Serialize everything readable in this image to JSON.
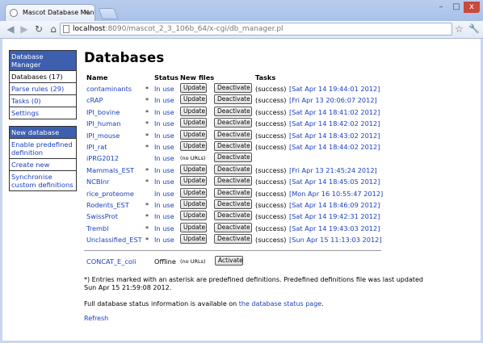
{
  "browser": {
    "tab_title": "Mascot Database Manager",
    "tab_close": "×",
    "url_host": "localhost",
    "url_rest": ":8090/mascot_2_3_106b_64/x-cgi/db_manager.pl",
    "icons": {
      "back": "◀",
      "forward": "▶",
      "reload": "↻",
      "home": "⌂",
      "star": "☆",
      "wrench": "🔧"
    }
  },
  "sidebar": {
    "menu1_head": "Database Manager",
    "menu1_items": [
      "Databases (17)",
      "Parse rules (29)",
      "Tasks (0)",
      "Settings"
    ],
    "menu2_head": "New database",
    "menu2_items": [
      "Enable predefined definition",
      "Create new",
      "Synchronise custom definitions"
    ]
  },
  "main": {
    "title": "Databases",
    "col_name": "Name",
    "col_status": "Status",
    "col_newfiles": "New files",
    "col_tasks": "Tasks",
    "btn_update": "Update",
    "btn_deactivate": "Deactivate",
    "btn_activate": "Activate",
    "no_urls": "(no URLs)",
    "success": "(success)",
    "rows": [
      {
        "name": "contaminants",
        "ast": "*",
        "status": "In use",
        "urls": true,
        "success": true,
        "task": "[Sat Apr 14 19:44:01 2012]"
      },
      {
        "name": "cRAP",
        "ast": "*",
        "status": "In use",
        "urls": true,
        "success": true,
        "task": "[Fri Apr 13 20:06:07 2012]"
      },
      {
        "name": "IPI_bovine",
        "ast": "*",
        "status": "In use",
        "urls": true,
        "success": true,
        "task": "[Sat Apr 14 18:41:02 2012]"
      },
      {
        "name": "IPI_human",
        "ast": "*",
        "status": "In use",
        "urls": true,
        "success": true,
        "task": "[Sat Apr 14 18:42:02 2012]"
      },
      {
        "name": "IPI_mouse",
        "ast": "*",
        "status": "In use",
        "urls": true,
        "success": true,
        "task": "[Sat Apr 14 18:43:02 2012]"
      },
      {
        "name": "IPI_rat",
        "ast": "*",
        "status": "In use",
        "urls": true,
        "success": true,
        "task": "[Sat Apr 14 18:44:02 2012]"
      },
      {
        "name": "iPRG2012",
        "ast": "",
        "status": "In use",
        "urls": false,
        "success": false,
        "task": ""
      },
      {
        "name": "Mammals_EST",
        "ast": "*",
        "status": "In use",
        "urls": true,
        "success": true,
        "task": "[Fri Apr 13 21:45:24 2012]"
      },
      {
        "name": "NCBInr",
        "ast": "*",
        "status": "In use",
        "urls": true,
        "success": true,
        "task": "[Sat Apr 14 18:45:05 2012]"
      },
      {
        "name": "rice_proteome",
        "ast": "",
        "status": "In use",
        "urls": true,
        "success": true,
        "task": "[Mon Apr 16 10:55:47 2012]"
      },
      {
        "name": "Rodents_EST",
        "ast": "*",
        "status": "In use",
        "urls": true,
        "success": true,
        "task": "[Sat Apr 14 18:46:09 2012]"
      },
      {
        "name": "SwissProt",
        "ast": "*",
        "status": "In use",
        "urls": true,
        "success": true,
        "task": "[Sat Apr 14 19:42:31 2012]"
      },
      {
        "name": "Trembl",
        "ast": "*",
        "status": "In use",
        "urls": true,
        "success": true,
        "task": "[Sat Apr 14 19:43:03 2012]"
      },
      {
        "name": "Unclassified_EST",
        "ast": "*",
        "status": "In use",
        "urls": true,
        "success": true,
        "task": "[Sun Apr 15 11:13:03 2012]"
      }
    ],
    "offline_row": {
      "name": "CONCAT_E_coli",
      "status": "Offline"
    },
    "note": "*) Entries marked with an asterisk are predefined definitions. Predefined definitions file was last updated Sun Apr 15 21:59:08 2012.",
    "status_prefix": "Full database status information is available on ",
    "status_link": "the database status page",
    "status_suffix": ".",
    "refresh": "Refresh"
  }
}
